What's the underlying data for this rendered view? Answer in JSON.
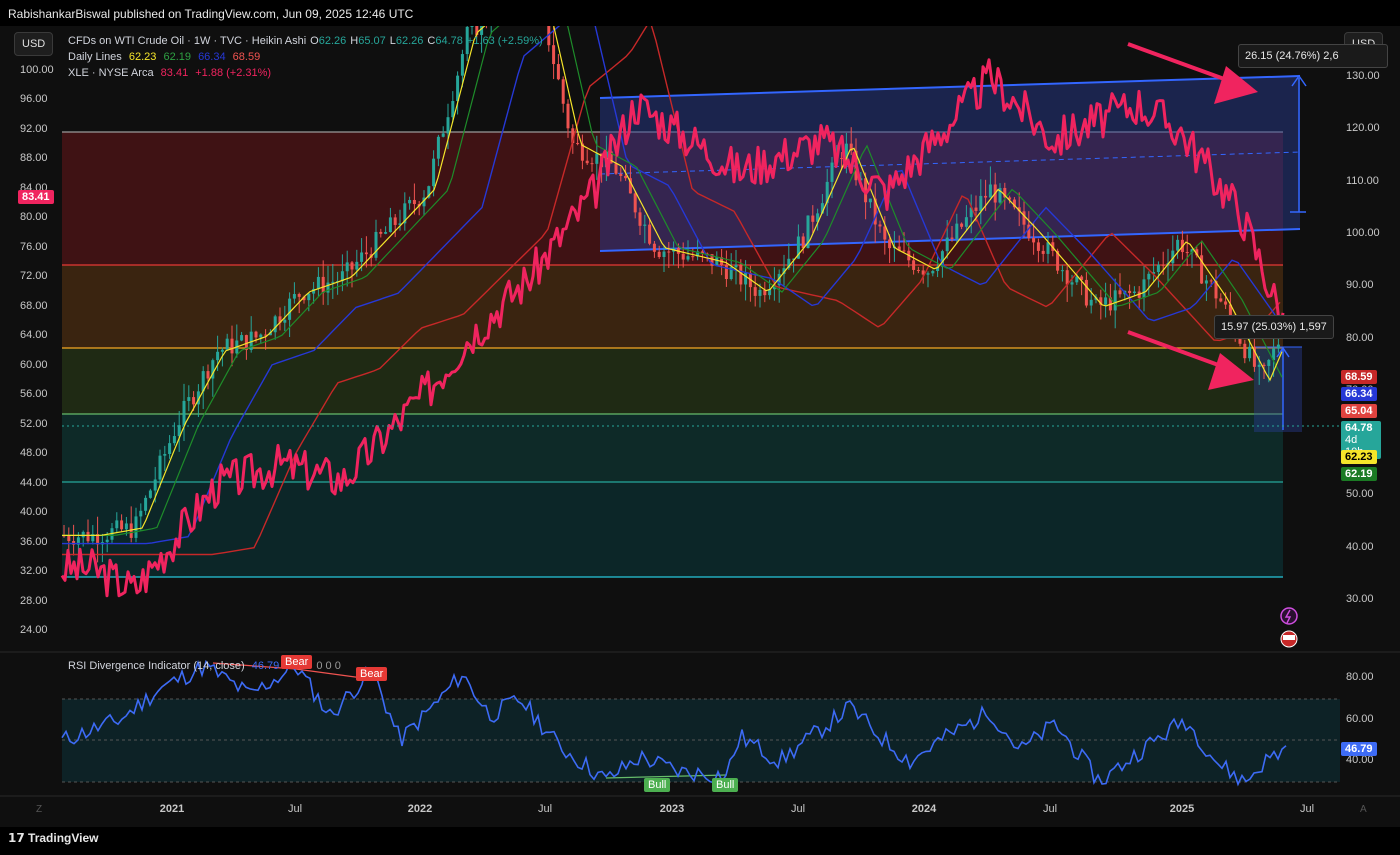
{
  "publisher": "RabishankarBiswal published on TradingView.com, Jun 09, 2025 12:46 UTC",
  "footer": "TradingView",
  "left_currency": "USD",
  "right_currency": "USD",
  "legend": {
    "line1": {
      "title": "CFDs on WTI Crude Oil · 1W · TVC · Heikin Ashi",
      "o_label": "O",
      "o": "62.26",
      "h_label": "H",
      "h": "65.07",
      "l_label": "L",
      "l": "62.26",
      "c_label": "C",
      "c": "64.78",
      "chg": "+1.63 (+2.59%)"
    },
    "line2": {
      "title": "Daily Lines",
      "v1": "62.23",
      "v2": "62.19",
      "v3": "66.34",
      "v4": "68.59"
    },
    "line3": {
      "title": "XLE · NYSE Arca",
      "v": "83.41",
      "chg": "+1.88 (+2.31%)"
    }
  },
  "rsi_legend": {
    "title": "RSI Divergence Indicator (14, close)",
    "value": "46.79",
    "zeros": "0  0  0"
  },
  "colors": {
    "ma_yellow": "#f5e52a",
    "ma_green": "#1e8c2a",
    "ma_blue": "#2638d6",
    "ma_red": "#c62828",
    "xle_pink": "#f0245f",
    "channel_blue": "#2f5ff0",
    "up": "#26a69a",
    "down": "#ef5350",
    "rsi_line": "#3d6bf5"
  },
  "chart_data": {
    "type": "line",
    "title": "CFDs on WTI Crude Oil · 1W · TVC · Heikin Ashi",
    "left_axis": {
      "ticks": [
        "100.00",
        "96.00",
        "92.00",
        "88.00",
        "84.00",
        "80.00",
        "76.00",
        "72.00",
        "68.00",
        "64.00",
        "60.00",
        "56.00",
        "52.00",
        "48.00",
        "44.00",
        "40.00",
        "36.00",
        "32.00",
        "28.00",
        "24.00"
      ],
      "range": [
        22,
        102
      ]
    },
    "right_axis": {
      "ticks": [
        "130.00",
        "120.00",
        "110.00",
        "100.00",
        "90.00",
        "80.00",
        "70.00",
        "60.00",
        "50.00",
        "40.00",
        "30.00"
      ],
      "range": [
        25,
        135
      ]
    },
    "x_ticks": [
      "2021",
      "Jul",
      "2022",
      "Jul",
      "2023",
      "Jul",
      "2024",
      "Jul",
      "2025",
      "Jul"
    ],
    "fib_levels": [
      92.0,
      74.9,
      63.6,
      54.4,
      44.9,
      32.0
    ],
    "series": [
      {
        "name": "CFDs on WTI Crude Oil",
        "x": [
          "2020-09",
          "2020-11",
          "2021-01",
          "2021-03",
          "2021-05",
          "2021-07",
          "2021-09",
          "2021-11",
          "2022-01",
          "2022-03",
          "2022-05",
          "2022-06",
          "2022-08",
          "2022-10",
          "2022-12",
          "2023-03",
          "2023-05",
          "2023-07",
          "2023-09",
          "2023-11",
          "2024-01",
          "2024-04",
          "2024-06",
          "2024-09",
          "2024-11",
          "2025-01",
          "2025-03",
          "2025-05",
          "2025-06"
        ],
        "values": [
          37,
          38,
          52,
          62,
          64,
          70,
          72,
          78,
          84,
          105,
          110,
          115,
          90,
          87,
          76,
          74,
          70,
          77,
          90,
          76,
          73,
          84,
          78,
          68,
          70,
          77,
          69,
          58,
          64.78
        ]
      },
      {
        "name": "XLE · NYSE Arca",
        "x": [
          "2020-09",
          "2020-11",
          "2021-03",
          "2021-06",
          "2021-09",
          "2022-01",
          "2022-03",
          "2022-06",
          "2022-09",
          "2022-11",
          "2023-04",
          "2023-08",
          "2023-11",
          "2024-04",
          "2024-07",
          "2024-11",
          "2025-01",
          "2025-04",
          "2025-06"
        ],
        "values": [
          36,
          32,
          52,
          56,
          53,
          70,
          80,
          92,
          108,
          125,
          112,
          118,
          108,
          130,
          118,
          125,
          120,
          104,
          83.41
        ]
      }
    ],
    "annotations": [
      {
        "text": "26.15 (24.76%) 2,6"
      },
      {
        "text": "15.97 (25.03%) 1,597"
      }
    ],
    "price_tags": [
      "83.41",
      "68.59",
      "66.34",
      "65.04",
      "64.78",
      "4d 10h",
      "62.23",
      "62.19"
    ],
    "rsi": {
      "ticks": [
        "80.00",
        "60.00",
        "40.00"
      ],
      "range": [
        28,
        88
      ],
      "last": 46.79,
      "labels": [
        "Bear",
        "Bear",
        "Bull",
        "Bull"
      ]
    }
  }
}
